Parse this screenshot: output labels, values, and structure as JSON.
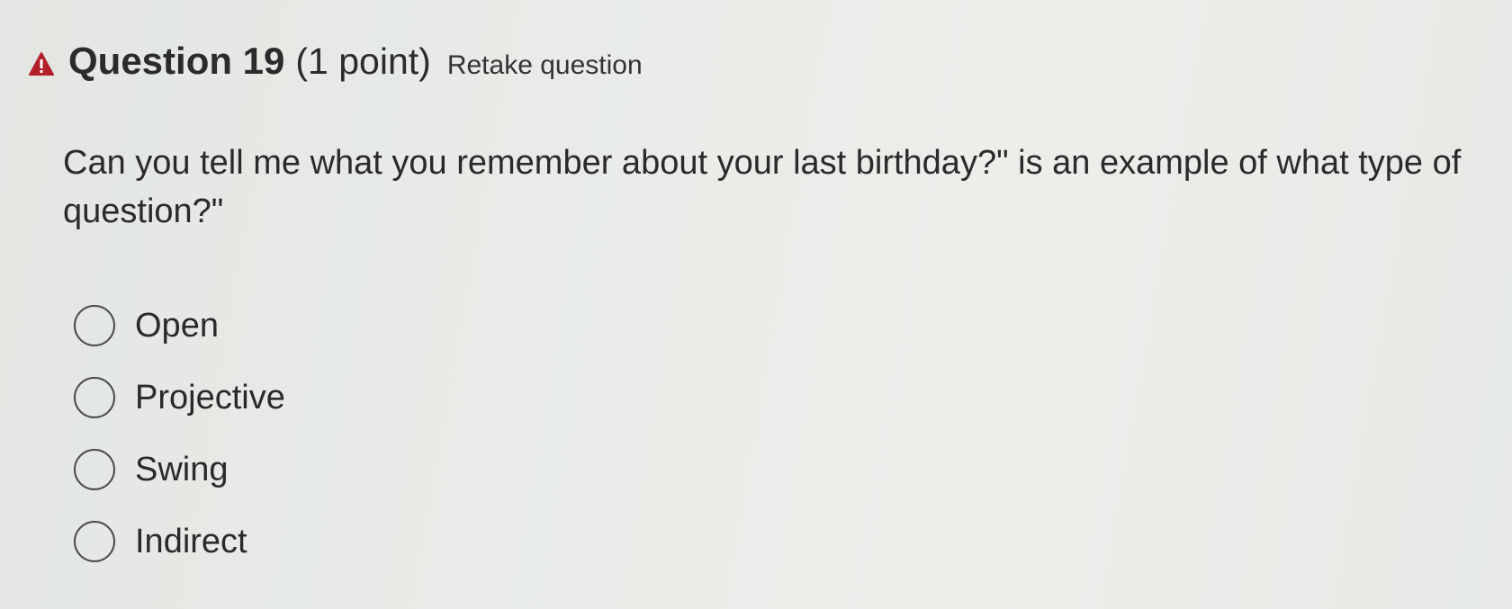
{
  "question": {
    "warning_icon": "warning-triangle-icon",
    "title": "Question 19",
    "points": "(1 point)",
    "retake_label": "Retake question",
    "prompt": "Can you tell me what you remember about your last birthday?\" is an example of what type of question?\""
  },
  "options": [
    {
      "label": "Open",
      "selected": false
    },
    {
      "label": "Projective",
      "selected": false
    },
    {
      "label": "Swing",
      "selected": false
    },
    {
      "label": "Indirect",
      "selected": false
    }
  ],
  "colors": {
    "warning": "#b3202a",
    "text": "#2b2b2b",
    "background": "#e8ebe7"
  }
}
